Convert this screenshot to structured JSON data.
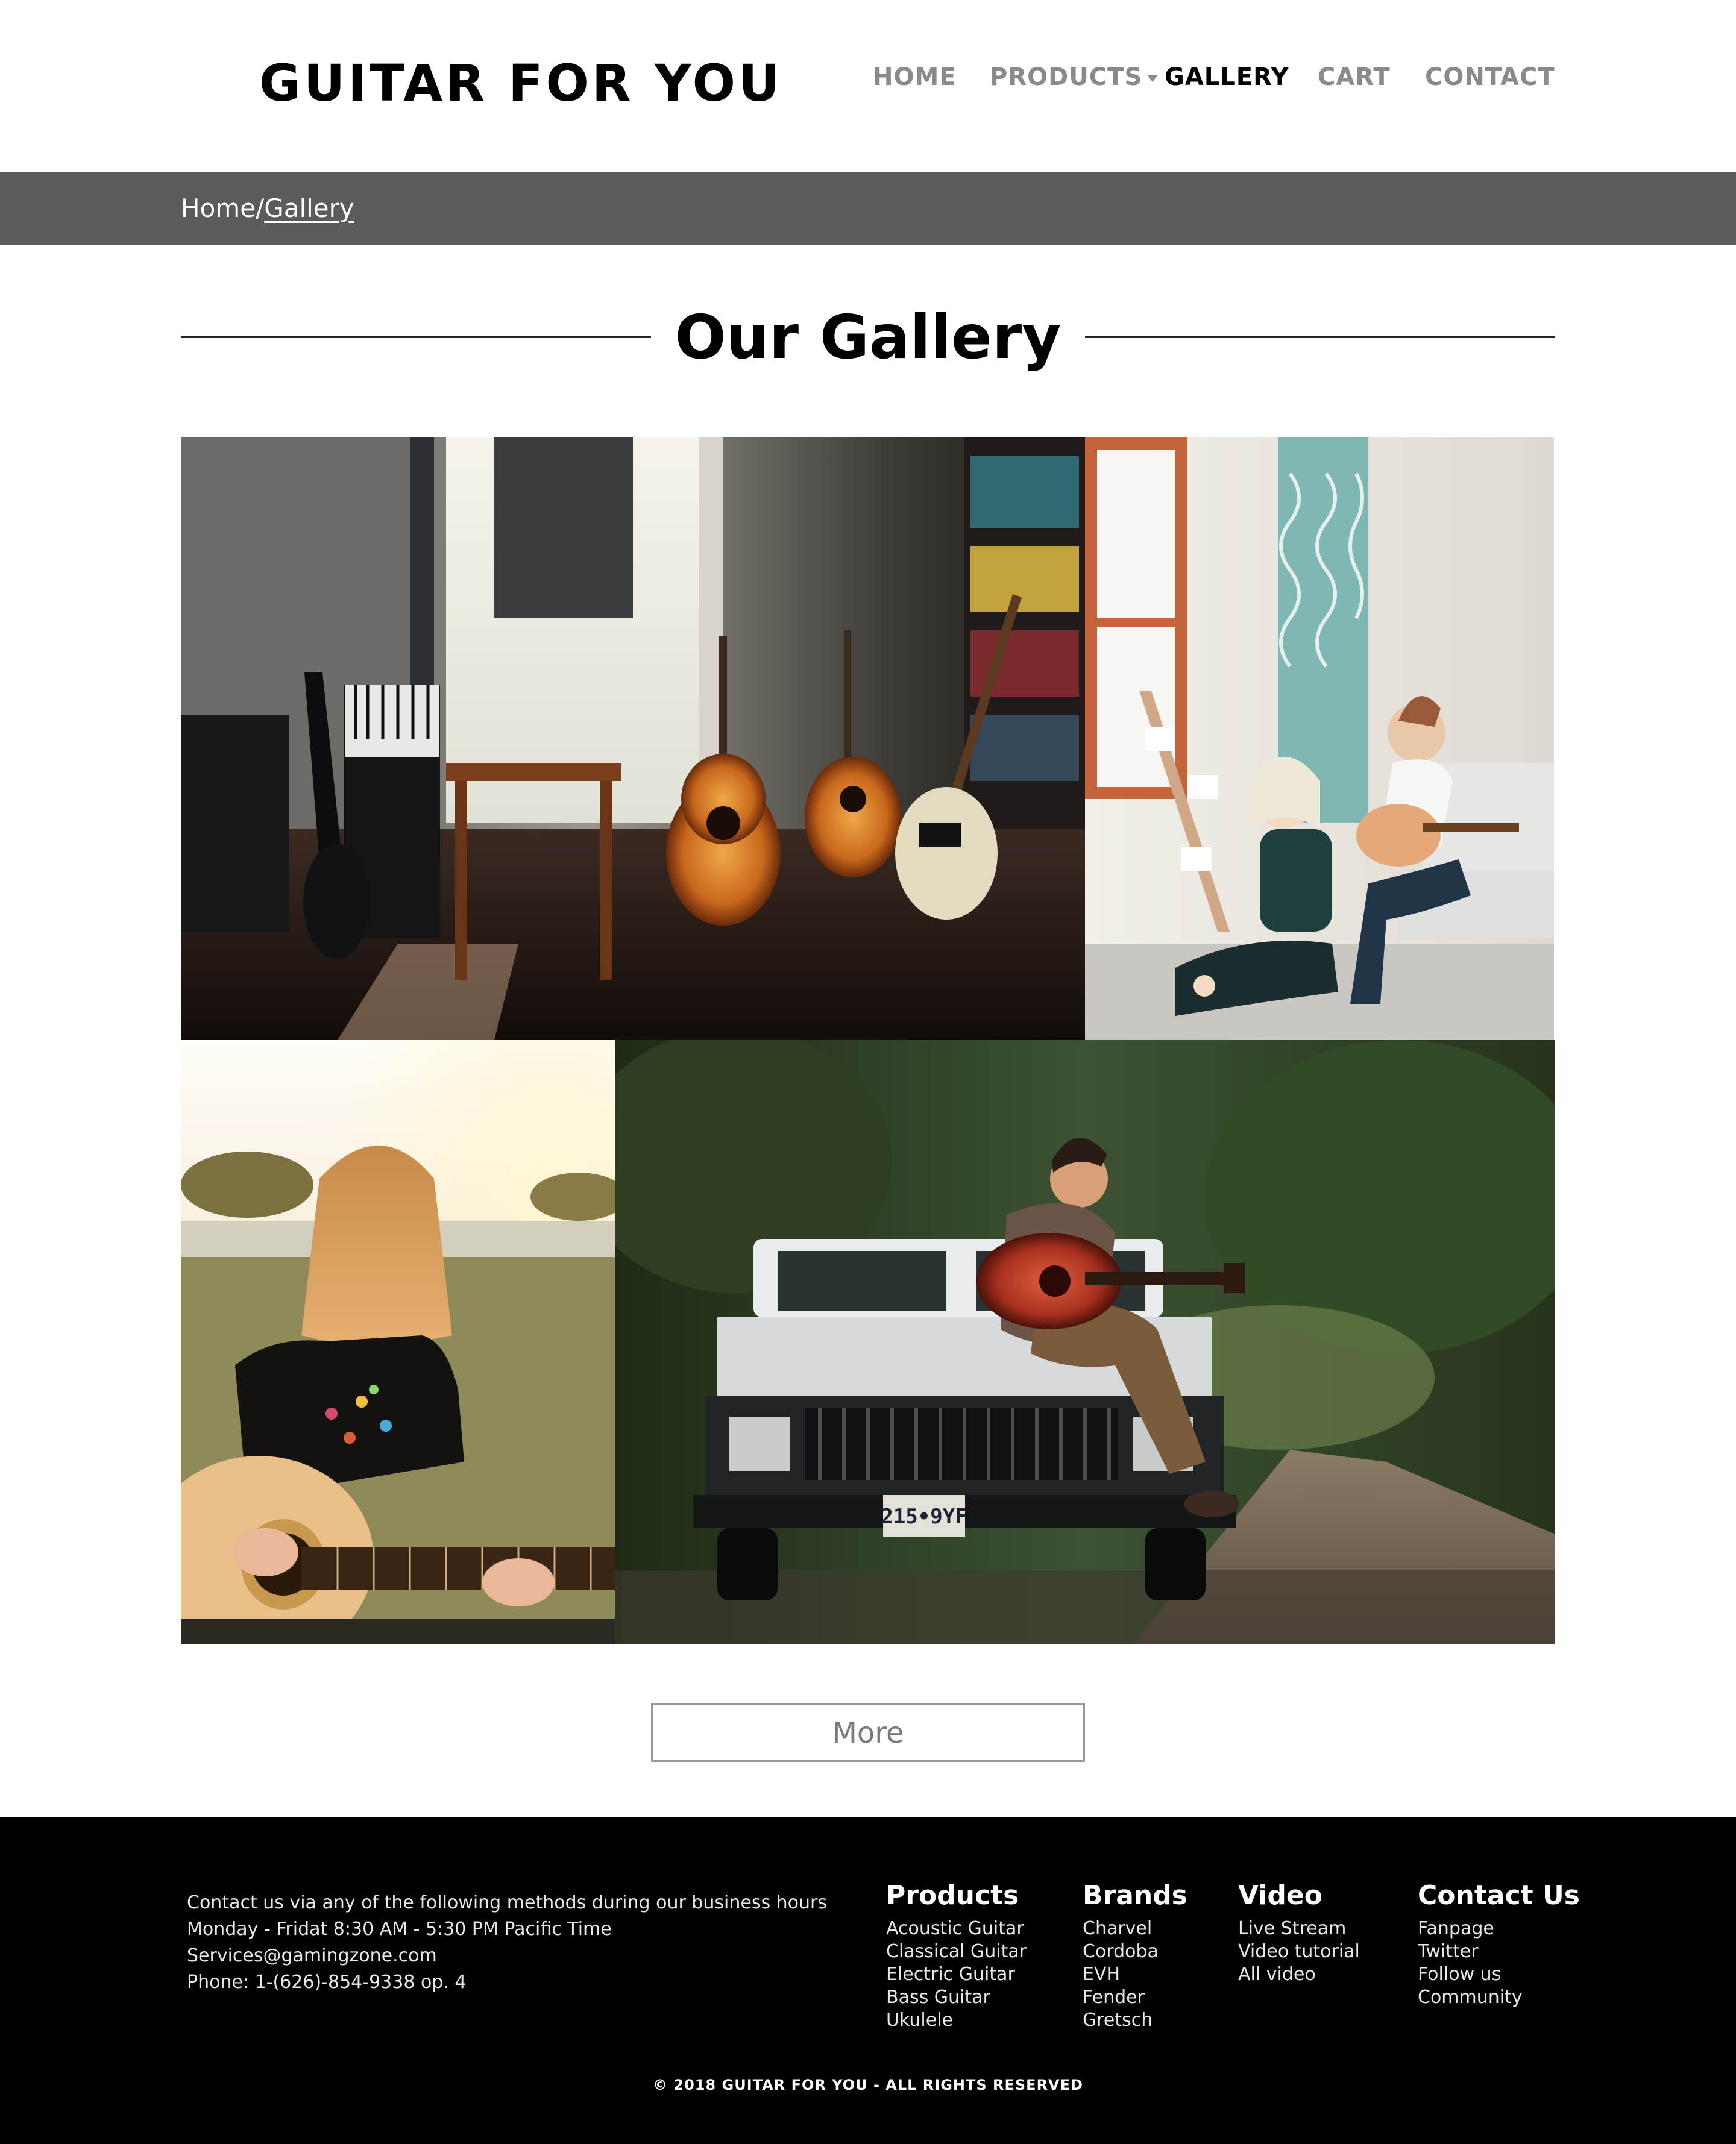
{
  "header": {
    "logo": "GUITAR FOR YOU",
    "nav": {
      "home": "HOME",
      "products": "PRODUCTS",
      "gallery": "GALLERY",
      "cart": "CART",
      "contact": "CONTACT"
    },
    "active_nav": "GALLERY"
  },
  "breadcrumb": {
    "home": "Home",
    "separator": "/",
    "current": "Gallery"
  },
  "main": {
    "title": "Our Gallery",
    "photos": [
      {
        "subject": "home studio with guitars, keyboard and bookshelf"
      },
      {
        "subject": "couple in living room, man playing acoustic guitar"
      },
      {
        "subject": "woman with red hair playing acoustic guitar at sunset"
      },
      {
        "subject": "man playing guitar sitting on a white jeep in the forest",
        "plate": "215•9YF"
      }
    ],
    "more_label": "More"
  },
  "footer": {
    "contact_lines": [
      "Contact us via any of the following methods during our business hours",
      "Monday - Fridat 8:30 AM - 5:30 PM Pacific Time",
      "Services@gamingzone.com",
      "Phone: 1-(626)-854-9338 op. 4"
    ],
    "columns": {
      "products": {
        "title": "Products",
        "items": [
          "Acoustic Guitar",
          "Classical Guitar",
          "Electric Guitar",
          "Bass Guitar",
          "Ukulele"
        ]
      },
      "brands": {
        "title": "Brands",
        "items": [
          "Charvel",
          "Cordoba",
          "EVH",
          "Fender",
          "Gretsch"
        ]
      },
      "video": {
        "title": "Video",
        "items": [
          "Live Stream",
          "Video tutorial",
          "All video"
        ]
      },
      "contact": {
        "title": "Contact Us",
        "items": [
          "Fanpage",
          "Twitter",
          "Follow us",
          "Community"
        ]
      }
    },
    "copyright": "© 2018 GUITAR FOR YOU - ALL RIGHTS RESERVED"
  },
  "colors": {
    "breadcrumb_bg": "#5b5b5b",
    "nav_inactive": "#8a8a8a",
    "nav_active": "#000000",
    "footer_bg": "#000000"
  },
  "icons": {
    "products_dropdown": "caret-down-icon"
  }
}
